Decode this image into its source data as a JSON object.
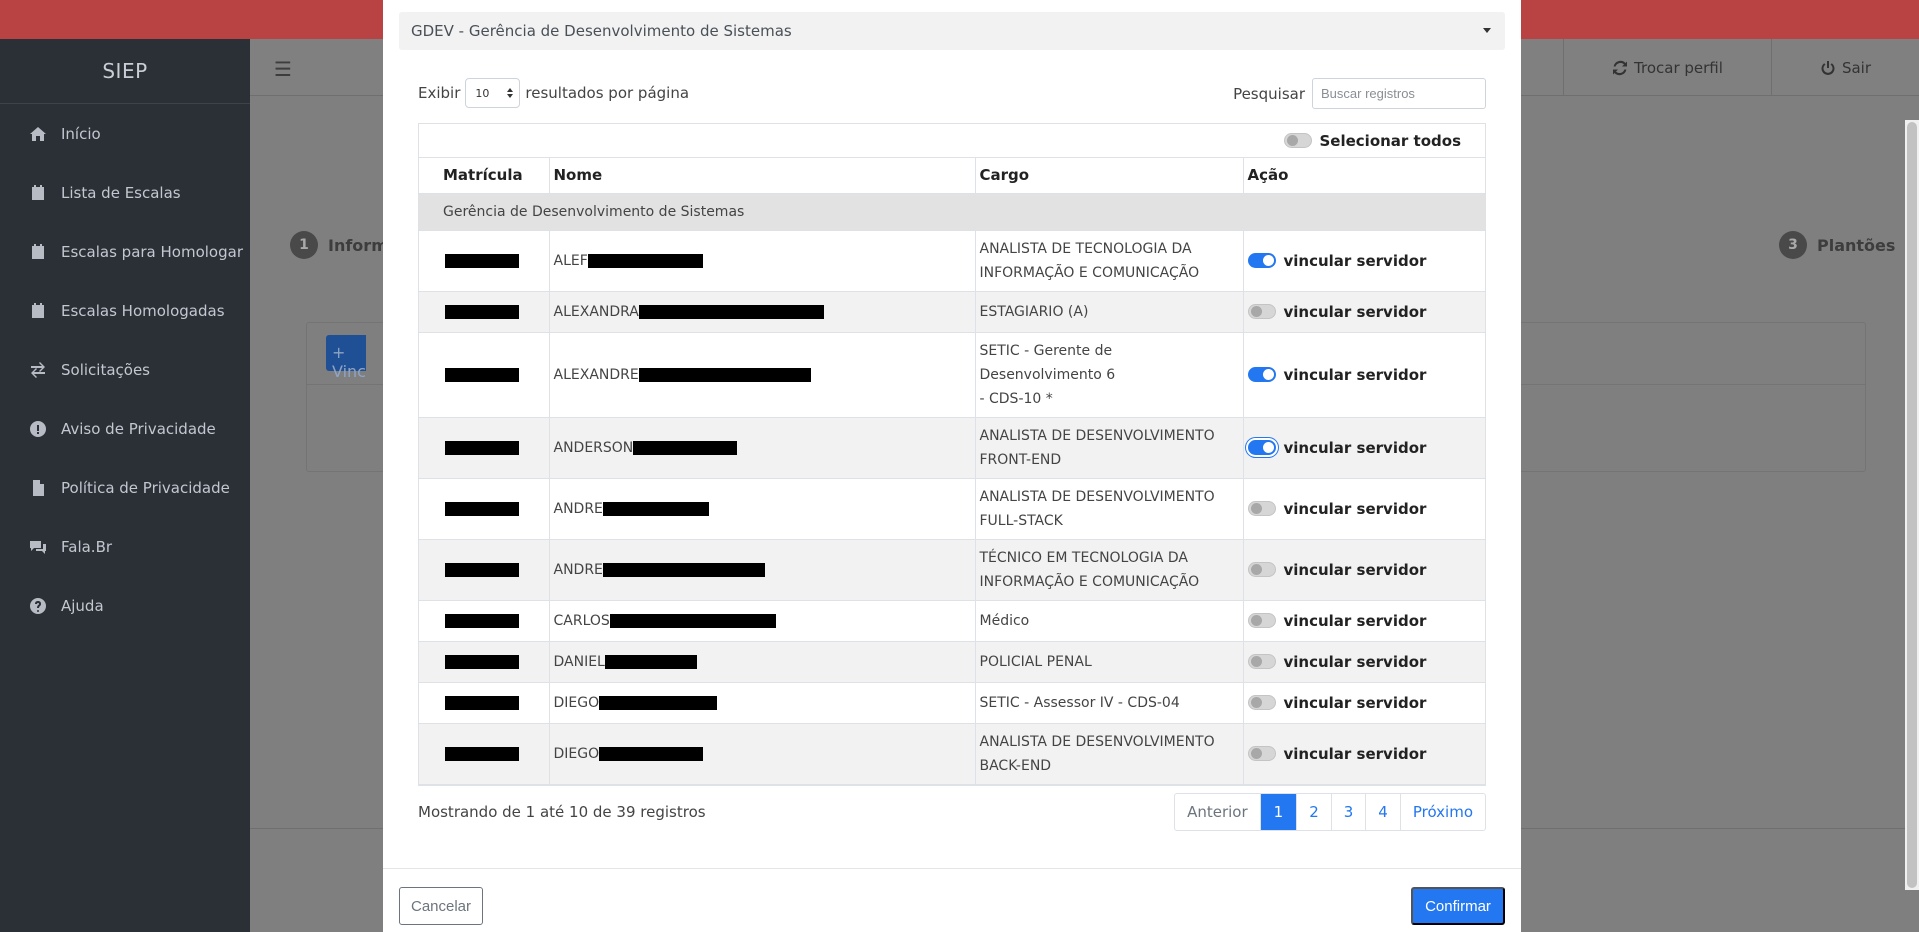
{
  "app": {
    "brand": "SIEP"
  },
  "sidebar": {
    "items": [
      {
        "label": "Início",
        "icon": "home-icon"
      },
      {
        "label": "Lista de Escalas",
        "icon": "calendar-icon"
      },
      {
        "label": "Escalas para Homologar",
        "icon": "calendar-minus-icon"
      },
      {
        "label": "Escalas Homologadas",
        "icon": "calendar-check-icon"
      },
      {
        "label": "Solicitações",
        "icon": "exchange-icon"
      },
      {
        "label": "Aviso de Privacidade",
        "icon": "exclamation-circle-icon"
      },
      {
        "label": "Política de Privacidade",
        "icon": "file-icon"
      },
      {
        "label": "Fala.Br",
        "icon": "comments-icon"
      },
      {
        "label": "Ajuda",
        "icon": "question-circle-icon"
      }
    ]
  },
  "header": {
    "switch_profile": "Trocar perfil",
    "logout": "Sair"
  },
  "steps": {
    "step1_num": "1",
    "step1_label": "Informa",
    "step3_num": "3",
    "step3_label": "Plantões"
  },
  "background_card": {
    "button_label": "+ Vinc"
  },
  "modal": {
    "unit_select": "GDEV - Gerência de Desenvolvimento de Sistemas",
    "length": {
      "prefix": "Exibir",
      "value": "10",
      "suffix": "resultados por página"
    },
    "search": {
      "label": "Pesquisar",
      "placeholder": "Buscar registros"
    },
    "select_all": "Selecionar todos",
    "columns": [
      "Matrícula",
      "Nome",
      "Cargo",
      "Ação"
    ],
    "group": "Gerência de Desenvolvimento de Sistemas",
    "action_label": "vincular servidor",
    "rows": [
      {
        "name": "ALEF",
        "cargo_1": "ANALISTA DE TECNOLOGIA DA",
        "cargo_2": "INFORMAÇÃO E COMUNICAÇÃO",
        "checked": true
      },
      {
        "name": "ALEXANDRA",
        "cargo_1": "ESTAGIARIO (A)",
        "cargo_2": "",
        "checked": false
      },
      {
        "name": "ALEXANDRE",
        "cargo_1": "SETIC - Gerente de Desenvolvimento 6",
        "cargo_2": "- CDS-10 *",
        "checked": true
      },
      {
        "name": "ANDERSON",
        "cargo_1": "ANALISTA DE DESENVOLVIMENTO",
        "cargo_2": "FRONT-END",
        "checked": true
      },
      {
        "name": "ANDRE",
        "cargo_1": "ANALISTA DE DESENVOLVIMENTO",
        "cargo_2": "FULL-STACK",
        "checked": false
      },
      {
        "name": "ANDRE",
        "cargo_1": "TÉCNICO EM TECNOLOGIA DA",
        "cargo_2": "INFORMAÇÃO E COMUNICAÇÃO",
        "checked": false
      },
      {
        "name": "CARLOS",
        "cargo_1": "Médico",
        "cargo_2": "",
        "checked": false
      },
      {
        "name": "DANIEL",
        "cargo_1": "POLICIAL PENAL",
        "cargo_2": "",
        "checked": false
      },
      {
        "name": "DIEGO",
        "cargo_1": "SETIC - Assessor IV - CDS-04",
        "cargo_2": "",
        "checked": false
      },
      {
        "name": "DIEGO",
        "cargo_1": "ANALISTA DE DESENVOLVIMENTO",
        "cargo_2": "BACK-END",
        "checked": false
      }
    ],
    "info": "Mostrando de 1 até 10 de 39 registros",
    "pagination": {
      "prev": "Anterior",
      "pages": [
        "1",
        "2",
        "3",
        "4"
      ],
      "next": "Próximo",
      "active": "1"
    },
    "cancel": "Cancelar",
    "confirm": "Confirmar"
  },
  "colors": {
    "primary": "#2377f0",
    "sidebar": "#2a3036",
    "topbar": "#b94343"
  }
}
